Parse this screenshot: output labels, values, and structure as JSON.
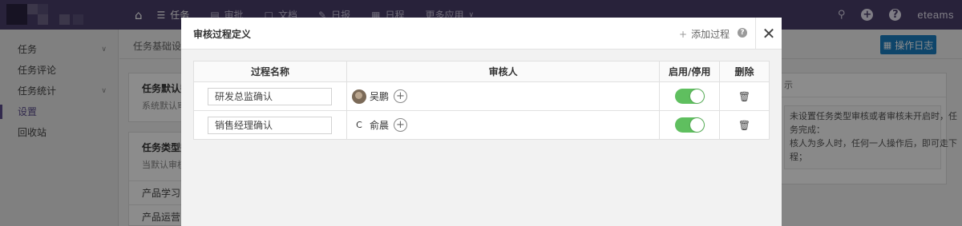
{
  "topnav": {
    "items": [
      {
        "label": "任务",
        "icon": "list-icon",
        "active": true
      },
      {
        "label": "审批",
        "icon": "approval-icon"
      },
      {
        "label": "文档",
        "icon": "document-icon"
      },
      {
        "label": "日报",
        "icon": "edit-icon"
      },
      {
        "label": "日程",
        "icon": "calendar-icon"
      },
      {
        "label": "更多应用",
        "icon": "chevron-down-icon"
      }
    ],
    "brand": "eteams"
  },
  "sidebar": {
    "items": [
      {
        "label": "任务",
        "has_arrow": true
      },
      {
        "label": "任务评论"
      },
      {
        "label": "任务统计",
        "has_arrow": true
      },
      {
        "label": "设置",
        "active": true
      },
      {
        "label": "回收站"
      }
    ]
  },
  "main": {
    "breadcrumb": "任务基础设置",
    "log_button": "操作日志",
    "card1": {
      "title": "任务默认完",
      "desc": "系统默认审"
    },
    "card2": {
      "title": "任务类型完",
      "desc": "当默认审核",
      "rows": [
        "产品学习",
        "产品运营"
      ]
    },
    "right_card": {
      "head": "示",
      "note_lines": [
        "未设置任务类型审核或者审核未开启时，任",
        "务完成：",
        "核人为多人时，任何一人操作后，即可走下",
        "程；"
      ]
    }
  },
  "modal": {
    "title": "审核过程定义",
    "add_label": "添加过程",
    "columns": [
      "过程名称",
      "审核人",
      "启用/停用",
      "删除"
    ],
    "rows": [
      {
        "name": "研发总监确认",
        "reviewer": "吴鹏",
        "avatar_type": "photo",
        "enabled": true
      },
      {
        "name": "销售经理确认",
        "reviewer": "俞晨",
        "avatar_letter": "C",
        "avatar_type": "letter",
        "enabled": true
      }
    ]
  },
  "colors": {
    "topbar": "#4a3f6b",
    "accent_button": "#1b7fc2",
    "toggle_on": "#5fbf5f"
  }
}
